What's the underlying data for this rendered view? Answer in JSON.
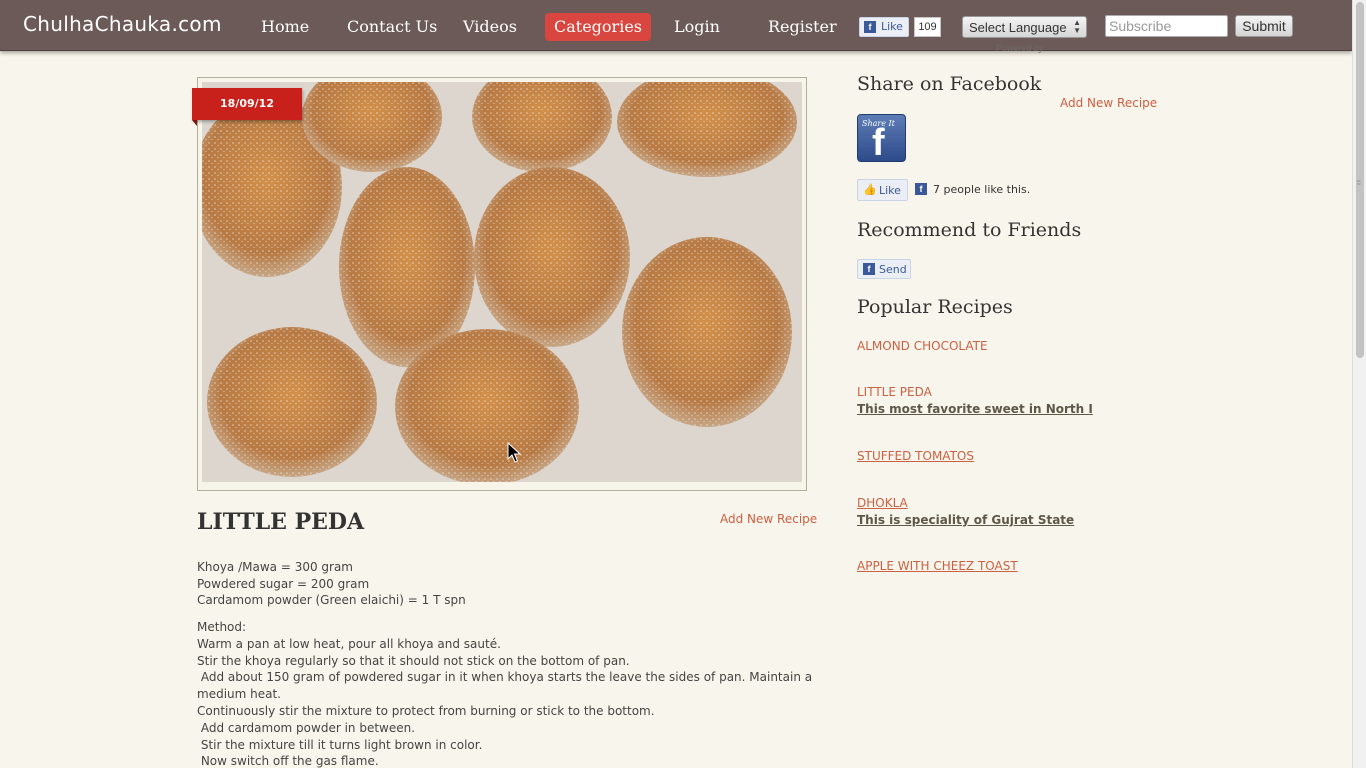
{
  "header": {
    "logo": "ChulhaChauka.com",
    "nav": [
      "Home",
      "Contact Us",
      "Videos",
      "Categories",
      "Login",
      "Register"
    ],
    "active_nav": "Categories",
    "fb_like_label": "Like",
    "fb_like_count": "109",
    "language_select": "Select Language",
    "powered_by": "Powered by",
    "subscribe_placeholder": "Subscribe",
    "submit_label": "Submit"
  },
  "post": {
    "date": "18/09/12",
    "image_subject": "sugar-coated peda sweets on a white tray",
    "title": "LITTLE PEDA",
    "add_recipe": "Add New Recipe",
    "ingredients": [
      "Khoya /Mawa = 300 gram",
      "Powdered sugar = 200 gram",
      "Cardamom powder (Green elaichi) = 1 T spn"
    ],
    "method": [
      "Method:",
      "Warm a pan at low heat, pour all khoya and sauté.",
      "Stir the khoya regularly so that it should not stick on the bottom of pan.",
      " Add about 150 gram of powdered sugar in it when khoya starts the leave the sides of pan. Maintain a medium heat.",
      "Continuously stir the mixture to protect from burning or stick to the bottom.",
      " Add cardamom powder in between.",
      " Stir the mixture till it turns light brown in color.",
      " Now switch off the gas flame."
    ]
  },
  "sidebar": {
    "share_heading": "Share on Facebook",
    "add_recipe": "Add New Recipe",
    "share_button_text": "Share It",
    "like_label": "Like",
    "like_count_text": "7 people like this.",
    "recommend_heading": "Recommend to Friends",
    "send_label": "Send",
    "popular_heading": "Popular Recipes",
    "popular": [
      {
        "name": "ALMOND CHOCOLATE",
        "desc": ""
      },
      {
        "name": "LITTLE PEDA",
        "desc": "This most favorite sweet in North I"
      },
      {
        "name": "STUFFED TOMATOS",
        "desc": ""
      },
      {
        "name": "DHOKLA",
        "desc": "This is speciality of Gujrat State"
      },
      {
        "name": "APPLE WITH CHEEZ TOAST",
        "desc": ""
      }
    ]
  },
  "colors": {
    "header_bg": "#6b5a57",
    "accent": "#d8463f",
    "link": "#cc6043",
    "page_bg": "#f8f6ec",
    "ribbon": "#c8201b"
  }
}
